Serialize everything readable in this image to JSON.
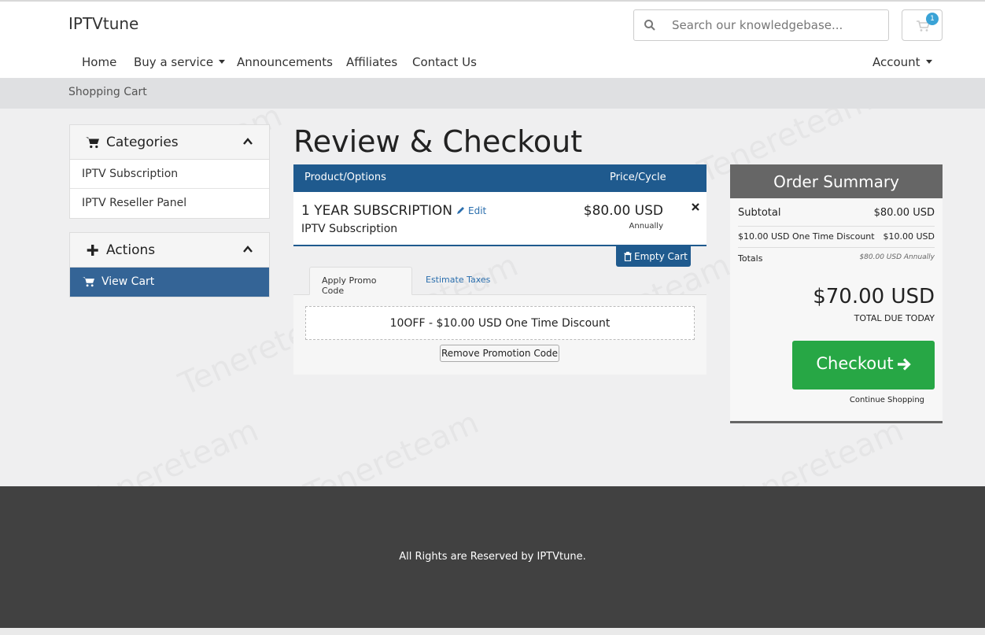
{
  "header": {
    "brand": "IPTVtune",
    "search_placeholder": "Search our knowledgebase...",
    "cart_count": "1"
  },
  "nav": {
    "home": "Home",
    "buy": "Buy a service",
    "announcements": "Announcements",
    "affiliates": "Affiliates",
    "contact": "Contact Us",
    "account": "Account"
  },
  "breadcrumb": "Shopping Cart",
  "sidebar": {
    "categories_title": "Categories",
    "categories": [
      "IPTV Subscription",
      "IPTV Reseller Panel"
    ],
    "actions_title": "Actions",
    "view_cart": "View Cart"
  },
  "main": {
    "title": "Review & Checkout",
    "col_product": "Product/Options",
    "col_price": "Price/Cycle",
    "item": {
      "name": "1 YEAR SUBSCRIPTION",
      "edit": "Edit",
      "group": "IPTV Subscription",
      "price": "$80.00 USD",
      "cycle": "Annually"
    },
    "empty_cart": "Empty Cart",
    "tabs": [
      "Apply Promo Code",
      "Estimate Taxes"
    ],
    "promo_applied": "10OFF - $10.00 USD One Time Discount",
    "remove_promo": "Remove Promotion Code"
  },
  "summary": {
    "title": "Order Summary",
    "subtotal_label": "Subtotal",
    "subtotal_value": "$80.00 USD",
    "discount_label": "$10.00 USD One Time Discount",
    "discount_value": "$10.00 USD",
    "totals_label": "Totals",
    "totals_value": "$80.00 USD Annually",
    "total_due": "$70.00 USD",
    "total_due_label": "TOTAL DUE TODAY",
    "checkout": "Checkout",
    "continue": "Continue Shopping"
  },
  "footer": {
    "text": "All Rights are Reserved by IPTVtune."
  },
  "colors": {
    "primary": "#1f5a8e",
    "sidebar_active": "#346496",
    "checkout": "#27a745",
    "summary_header": "#666666",
    "footer": "#414141"
  }
}
